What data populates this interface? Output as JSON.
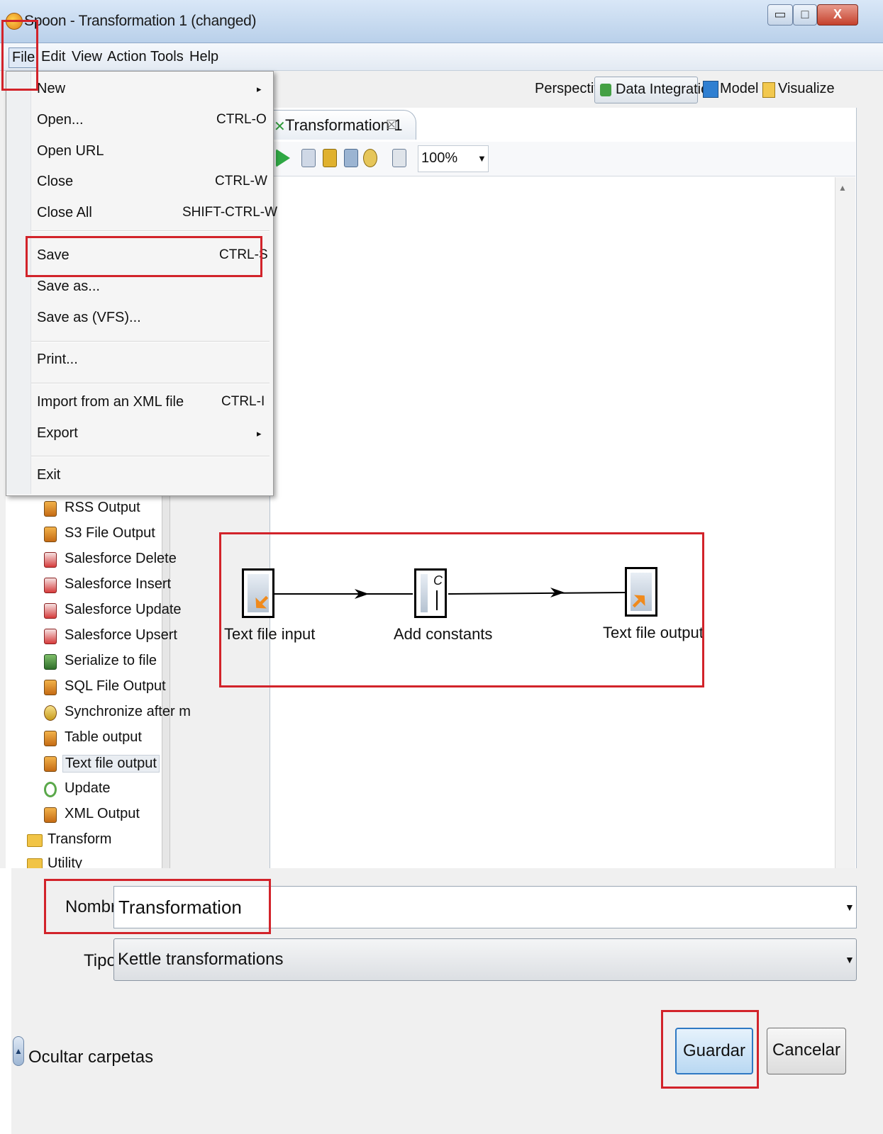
{
  "window": {
    "title": "Spoon - Transformation 1 (changed)",
    "controls": {
      "minimize": "▭",
      "maximize": "□",
      "close": "X"
    }
  },
  "menubar": {
    "items": [
      {
        "label": "File"
      },
      {
        "label": "Edit"
      },
      {
        "label": "View"
      },
      {
        "label": "Action"
      },
      {
        "label": "Tools"
      },
      {
        "label": "Help"
      }
    ]
  },
  "file_menu": {
    "items": [
      {
        "label": "New",
        "shortcut": "",
        "submenu": true
      },
      {
        "label": "Open...",
        "shortcut": "CTRL-O"
      },
      {
        "label": "Open URL",
        "shortcut": ""
      },
      {
        "label": "Close",
        "shortcut": "CTRL-W"
      },
      {
        "label": "Close All",
        "shortcut": "SHIFT-CTRL-W"
      },
      {
        "label": "Save",
        "shortcut": "CTRL-S"
      },
      {
        "label": "Save as...",
        "shortcut": ""
      },
      {
        "label": "Save as (VFS)...",
        "shortcut": ""
      },
      {
        "label": "Print...",
        "shortcut": ""
      },
      {
        "label": "Import from an XML file",
        "shortcut": "CTRL-I"
      },
      {
        "label": "Export",
        "shortcut": "",
        "submenu": true
      },
      {
        "label": "Exit",
        "shortcut": ""
      }
    ],
    "submenu_arrow": "▸"
  },
  "perspective": {
    "label": "Perspective:",
    "options": [
      {
        "label": "Data Integration",
        "icon": "data-integration-icon",
        "active": true
      },
      {
        "label": "Model",
        "icon": "model-icon"
      },
      {
        "label": "Visualize",
        "icon": "visualize-icon"
      }
    ]
  },
  "tab": {
    "label": "Transformation 1",
    "icon": "transformation-icon",
    "close": "☒"
  },
  "toolbar": {
    "zoom": "100%",
    "dropdown_arrow": "▼"
  },
  "canvas": {
    "steps": [
      {
        "label": "Text file input",
        "icon": "text-file-input-icon"
      },
      {
        "label": "Add constants",
        "icon": "add-constants-icon"
      },
      {
        "label": "Text file output",
        "icon": "text-file-output-icon"
      }
    ],
    "constants_glyph": "C",
    "scroll_up": "▲"
  },
  "tree": {
    "items": [
      {
        "label": "RSS Output",
        "icon": "rss-output-icon"
      },
      {
        "label": "S3 File Output",
        "icon": "s3-file-output-icon"
      },
      {
        "label": "Salesforce Delete",
        "icon": "salesforce-delete-icon"
      },
      {
        "label": "Salesforce Insert",
        "icon": "salesforce-insert-icon"
      },
      {
        "label": "Salesforce Update",
        "icon": "salesforce-update-icon"
      },
      {
        "label": "Salesforce Upsert",
        "icon": "salesforce-upsert-icon"
      },
      {
        "label": "Serialize to file",
        "icon": "serialize-icon"
      },
      {
        "label": "SQL File Output",
        "icon": "sql-file-output-icon"
      },
      {
        "label": "Synchronize after m",
        "icon": "synchronize-icon"
      },
      {
        "label": "Table output",
        "icon": "table-output-icon"
      },
      {
        "label": "Text file output",
        "icon": "text-file-output-icon",
        "selected": true
      },
      {
        "label": "Update",
        "icon": "update-icon"
      },
      {
        "label": "XML Output",
        "icon": "xml-output-icon"
      }
    ],
    "folders": [
      {
        "label": "Transform",
        "icon": "folder-icon"
      },
      {
        "label": "Utility",
        "icon": "folder-icon"
      }
    ]
  },
  "save_dialog": {
    "nombre_label": "Nombre:",
    "nombre_value": "Transformation",
    "tipo_label": "Tipo:",
    "tipo_value": "Kettle transformations",
    "dropdown_arrow": "▼",
    "ocultar_label": "Ocultar carpetas",
    "ocultar_arrow": "▲",
    "guardar_label": "Guardar",
    "cancelar_label": "Cancelar"
  },
  "colors": {
    "highlight_box": "#d2232a",
    "primary_button": "#2f79c3",
    "titlebar": "#c9dcf1"
  }
}
